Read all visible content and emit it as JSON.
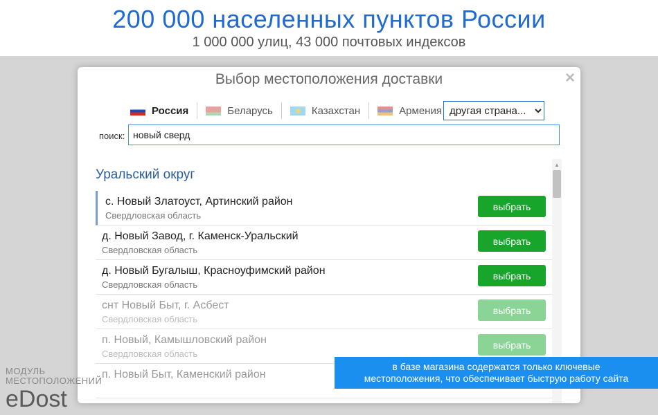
{
  "banner": {
    "title": "200 000 населенных пунктов России",
    "subtitle": "1 000 000 улиц, 43 000 почтовых индексов"
  },
  "modal": {
    "title": "Выбор местоположения доставки",
    "close_icon": "×"
  },
  "countries": [
    {
      "label": "Россия",
      "flag": "flag-ru-icon",
      "active": true
    },
    {
      "label": "Беларусь",
      "flag": "flag-by-icon"
    },
    {
      "label": "Казахстан",
      "flag": "flag-kz-icon"
    },
    {
      "label": "Армения",
      "flag": "flag-am-icon"
    }
  ],
  "country_select": {
    "selected": "другая страна..."
  },
  "search": {
    "label": "поиск:",
    "value": "новый сверд"
  },
  "region": "Уральский округ",
  "results": [
    {
      "name": "с. Новый Златоуст, Артинский район",
      "sub": "Свердловская область",
      "button": "выбрать",
      "selected": true
    },
    {
      "name": "д. Новый Завод, г. Каменск-Уральский",
      "sub": "Свердловская область",
      "button": "выбрать"
    },
    {
      "name": "д. Новый Бугалыш, Красноуфимский район",
      "sub": "Свердловская область",
      "button": "выбрать"
    },
    {
      "name": "снт Новый Быт, г. Асбест",
      "sub": "Свердловская область",
      "button": "выбрать",
      "faded": true
    },
    {
      "name": "п. Новый, Камышловский район",
      "sub": "Свердловская область",
      "button": "выбрать",
      "faded": true
    },
    {
      "name": "п. Новый Быт, Каменский район",
      "sub": "",
      "button": "",
      "faded": true
    }
  ],
  "tooltip": {
    "line1": "в базе магазина содержатся только ключевые",
    "line2": "местоположения, что обеспечивает быструю работу сайта"
  },
  "watermark": {
    "line1": "МОДУЛЬ",
    "line2": "МЕСТОПОЛОЖЕНИЙ",
    "brand": "eDost"
  },
  "colors": {
    "accent": "#1f6bd0",
    "button": "#17a52b",
    "button_faded": "#8ad596",
    "tooltip": "#1b8ff0"
  }
}
